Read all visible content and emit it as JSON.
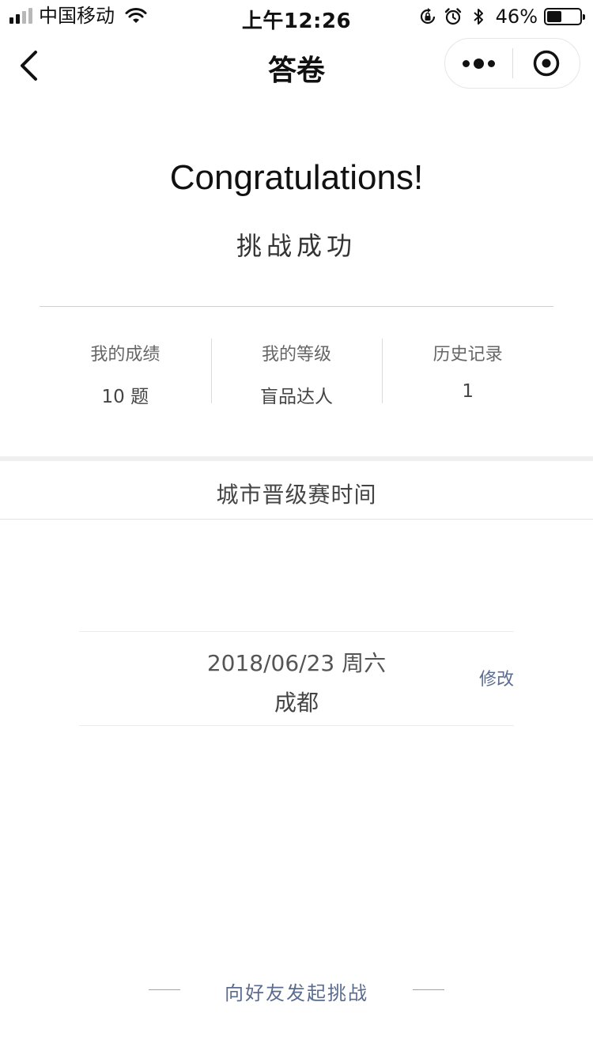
{
  "status_bar": {
    "carrier": "中国移动",
    "time": "上午12:26",
    "battery_percent": "46%",
    "icons": [
      "signal-icon",
      "wifi-icon",
      "orientation-lock-icon",
      "alarm-icon",
      "bluetooth-icon",
      "battery-icon"
    ]
  },
  "nav": {
    "title": "答卷",
    "icons": [
      "back-chevron-icon",
      "more-dots-icon",
      "close-target-icon"
    ]
  },
  "hero": {
    "title": "Congratulations!",
    "subtitle": "挑战成功"
  },
  "stats": [
    {
      "label": "我的成绩",
      "value": "10 题"
    },
    {
      "label": "我的等级",
      "value": "盲品达人"
    },
    {
      "label": "历史记录",
      "value": "1"
    }
  ],
  "section": {
    "title": "城市晋级赛时间"
  },
  "event": {
    "date": "2018/06/23  周六",
    "city": "成都",
    "edit_label": "修改"
  },
  "footer": {
    "challenge_label": "向好友发起挑战"
  },
  "colors": {
    "link": "#5b6c8f",
    "divider": "#efefef"
  }
}
